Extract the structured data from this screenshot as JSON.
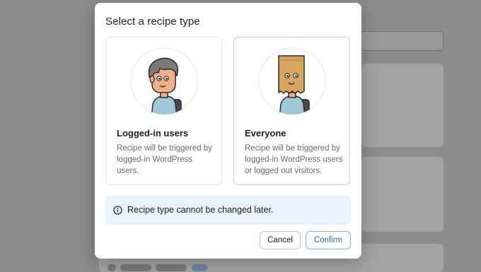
{
  "dialog": {
    "title": "Select a recipe type",
    "options": [
      {
        "label": "Logged-in users",
        "description": "Recipe will be triggered by logged-in WordPress users.",
        "icon": "logged-in-user-avatar-icon",
        "selected": false
      },
      {
        "label": "Everyone",
        "description": "Recipe will be triggered by logged-in WordPress users or logged out visitors.",
        "icon": "paper-bag-head-avatar-icon",
        "selected": true
      }
    ],
    "notice": {
      "icon": "info-icon",
      "text": "Recipe type cannot be changed later."
    },
    "buttons": {
      "cancel_label": "Cancel",
      "confirm_label": "Confirm"
    }
  },
  "colors": {
    "accent": "#2271b1",
    "notice_bg": "#e9f3fd",
    "overlay": "#8c8c8c"
  }
}
